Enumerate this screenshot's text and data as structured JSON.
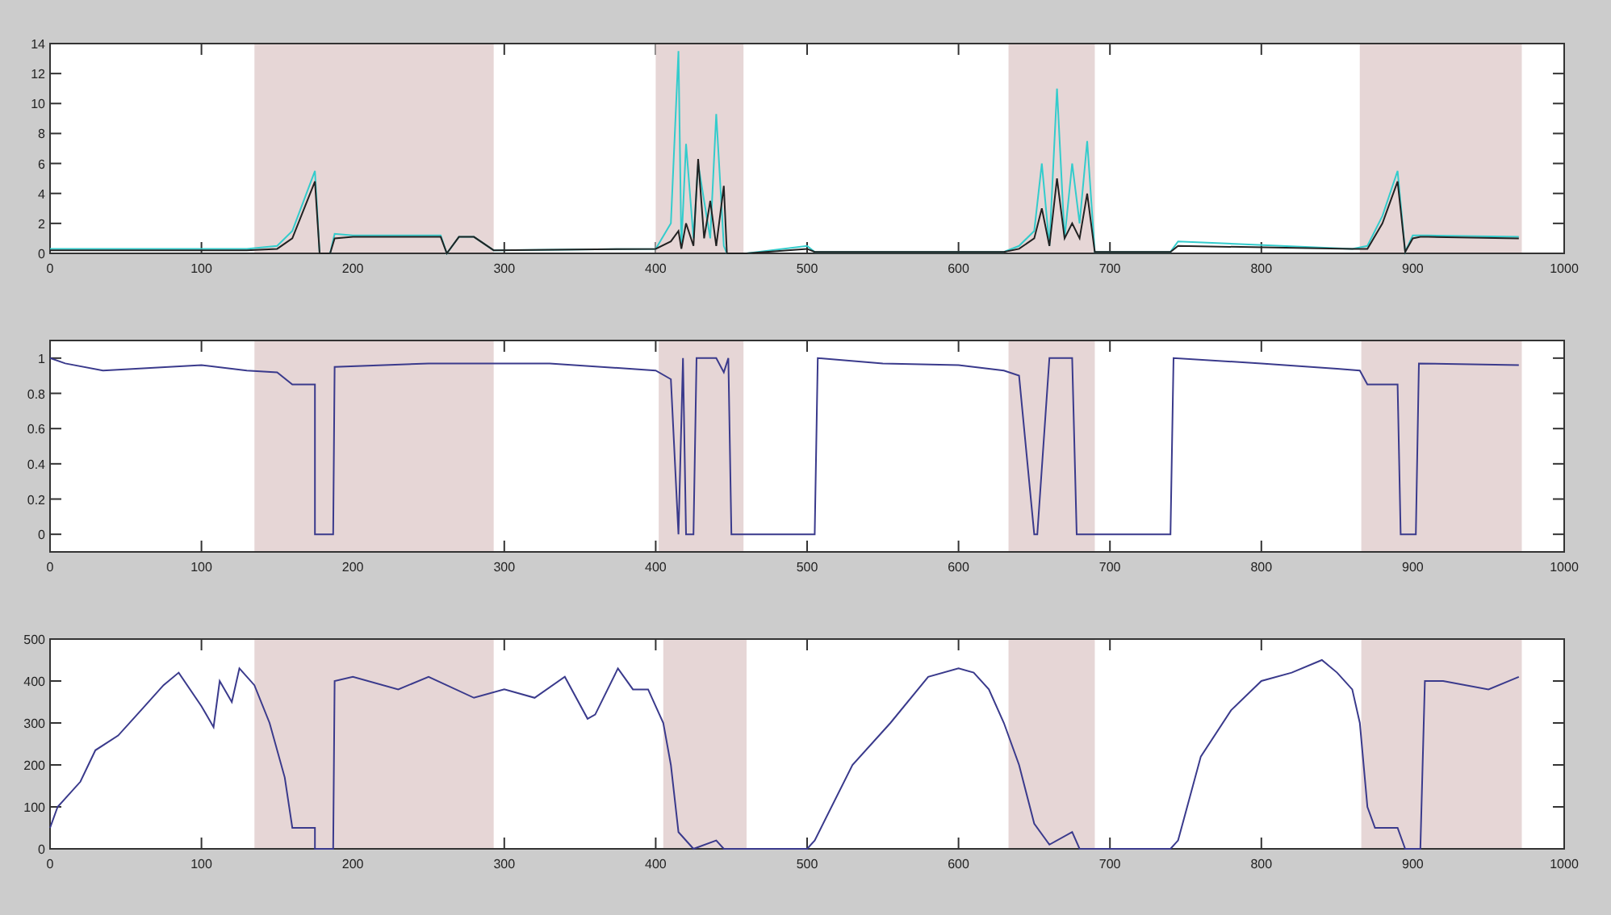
{
  "charts": [
    {
      "chart_data": {
        "type": "line",
        "x": [
          0,
          130,
          150,
          160,
          175,
          178,
          185,
          188,
          200,
          258,
          262,
          270,
          280,
          293,
          400,
          410,
          415,
          417,
          420,
          425,
          428,
          432,
          436,
          440,
          445,
          447,
          450,
          460,
          500,
          505,
          630,
          640,
          650,
          655,
          660,
          665,
          670,
          675,
          680,
          685,
          690,
          740,
          745,
          860,
          870,
          880,
          890,
          895,
          900,
          905,
          910,
          970
        ],
        "series": [
          {
            "color": "#33cccc",
            "values": [
              0.3,
              0.3,
              0.5,
              1.5,
              5.5,
              0,
              0,
              1.3,
              1.2,
              1.2,
              0,
              1.1,
              1.1,
              0.2,
              0.3,
              2,
              13.5,
              0.5,
              7.3,
              1,
              6,
              3.5,
              1,
              9.3,
              0.5,
              0,
              0,
              0,
              0.5,
              0.1,
              0.1,
              0.5,
              1.5,
              6,
              0.5,
              11,
              1,
              6,
              2,
              7.5,
              0.1,
              0.1,
              0.8,
              0.3,
              0.5,
              2.5,
              5.5,
              0.1,
              1.2,
              1.2,
              1.2,
              1.1
            ]
          },
          {
            "color": "#222222",
            "values": [
              0.2,
              0.2,
              0.3,
              1,
              4.8,
              0,
              0,
              1,
              1.1,
              1.1,
              0,
              1.1,
              1.1,
              0.2,
              0.3,
              0.8,
              1.5,
              0.3,
              2,
              0.5,
              6.3,
              1,
              3.5,
              0.5,
              4.5,
              0,
              0,
              0,
              0.3,
              0.1,
              0.1,
              0.3,
              1,
              3,
              0.5,
              5,
              1,
              2,
              1,
              4,
              0.1,
              0.1,
              0.5,
              0.3,
              0.3,
              2,
              4.8,
              0.1,
              1,
              1.1,
              1.1,
              1
            ]
          }
        ],
        "xlim": [
          0,
          1000
        ],
        "ylim": [
          0,
          14
        ],
        "xticks": [
          0,
          100,
          200,
          300,
          400,
          500,
          600,
          700,
          800,
          900,
          1000
        ],
        "yticks": [
          0,
          2,
          4,
          6,
          8,
          10,
          12,
          14
        ],
        "bands": [
          {
            "axis": "x",
            "from": 135,
            "to": 293
          },
          {
            "axis": "x",
            "from": 400,
            "to": 458
          },
          {
            "axis": "x",
            "from": 633,
            "to": 690
          },
          {
            "axis": "x",
            "from": 865,
            "to": 972
          }
        ]
      }
    },
    {
      "chart_data": {
        "type": "line",
        "x": [
          0,
          10,
          35,
          100,
          130,
          150,
          160,
          162,
          175,
          175,
          187,
          188,
          250,
          300,
          330,
          400,
          410,
          415,
          418,
          420,
          425,
          427,
          440,
          445,
          448,
          450,
          505,
          507,
          550,
          600,
          630,
          640,
          650,
          652,
          660,
          662,
          675,
          678,
          700,
          740,
          742,
          800,
          850,
          865,
          870,
          890,
          892,
          902,
          904,
          970
        ],
        "series": [
          {
            "color": "#3a3a8c",
            "values": [
              1,
              0.97,
              0.93,
              0.96,
              0.93,
              0.92,
              0.85,
              0.85,
              0.85,
              0,
              0,
              0.95,
              0.97,
              0.97,
              0.97,
              0.93,
              0.88,
              0,
              1,
              0,
              0,
              1,
              1,
              0.92,
              1,
              0,
              0,
              1,
              0.97,
              0.96,
              0.93,
              0.9,
              0,
              0,
              1,
              1,
              1,
              0,
              0,
              0,
              1,
              0.97,
              0.94,
              0.93,
              0.85,
              0.85,
              0,
              0,
              0.97,
              0.96
            ]
          }
        ],
        "xlim": [
          0,
          1000
        ],
        "ylim": [
          -0.1,
          1.1
        ],
        "xticks": [
          0,
          100,
          200,
          300,
          400,
          500,
          600,
          700,
          800,
          900,
          1000
        ],
        "yticks": [
          0,
          0.2,
          0.4,
          0.6,
          0.8,
          1
        ],
        "bands": [
          {
            "axis": "x",
            "from": 135,
            "to": 293
          },
          {
            "axis": "x",
            "from": 402,
            "to": 458
          },
          {
            "axis": "x",
            "from": 633,
            "to": 690
          },
          {
            "axis": "x",
            "from": 866,
            "to": 972
          }
        ]
      }
    },
    {
      "chart_data": {
        "type": "line",
        "x": [
          0,
          5,
          20,
          30,
          45,
          60,
          75,
          85,
          100,
          108,
          112,
          120,
          125,
          135,
          145,
          155,
          160,
          175,
          175,
          187,
          188,
          200,
          230,
          250,
          280,
          300,
          320,
          340,
          355,
          360,
          375,
          385,
          395,
          405,
          410,
          415,
          425,
          440,
          445,
          500,
          505,
          530,
          555,
          580,
          600,
          610,
          620,
          630,
          640,
          650,
          660,
          675,
          680,
          740,
          745,
          760,
          780,
          800,
          820,
          840,
          850,
          860,
          865,
          870,
          875,
          890,
          895,
          905,
          908,
          920,
          950,
          970
        ],
        "series": [
          {
            "color": "#3a3a8c",
            "values": [
              50,
              100,
              160,
              235,
              270,
              330,
              390,
              420,
              340,
              290,
              400,
              350,
              430,
              390,
              300,
              170,
              50,
              50,
              0,
              0,
              400,
              410,
              380,
              410,
              360,
              380,
              360,
              410,
              310,
              320,
              430,
              380,
              380,
              300,
              200,
              40,
              0,
              20,
              0,
              0,
              20,
              200,
              300,
              410,
              430,
              420,
              380,
              300,
              200,
              60,
              10,
              40,
              0,
              0,
              20,
              220,
              330,
              400,
              420,
              450,
              420,
              380,
              300,
              100,
              50,
              50,
              0,
              0,
              400,
              400,
              380,
              410
            ]
          }
        ],
        "xlim": [
          0,
          1000
        ],
        "ylim": [
          0,
          500
        ],
        "xticks": [
          0,
          100,
          200,
          300,
          400,
          500,
          600,
          700,
          800,
          900,
          1000
        ],
        "yticks": [
          0,
          100,
          200,
          300,
          400,
          500
        ],
        "bands": [
          {
            "axis": "x",
            "from": 135,
            "to": 293
          },
          {
            "axis": "x",
            "from": 405,
            "to": 460
          },
          {
            "axis": "x",
            "from": 633,
            "to": 690
          },
          {
            "axis": "x",
            "from": 866,
            "to": 972
          }
        ]
      }
    }
  ]
}
